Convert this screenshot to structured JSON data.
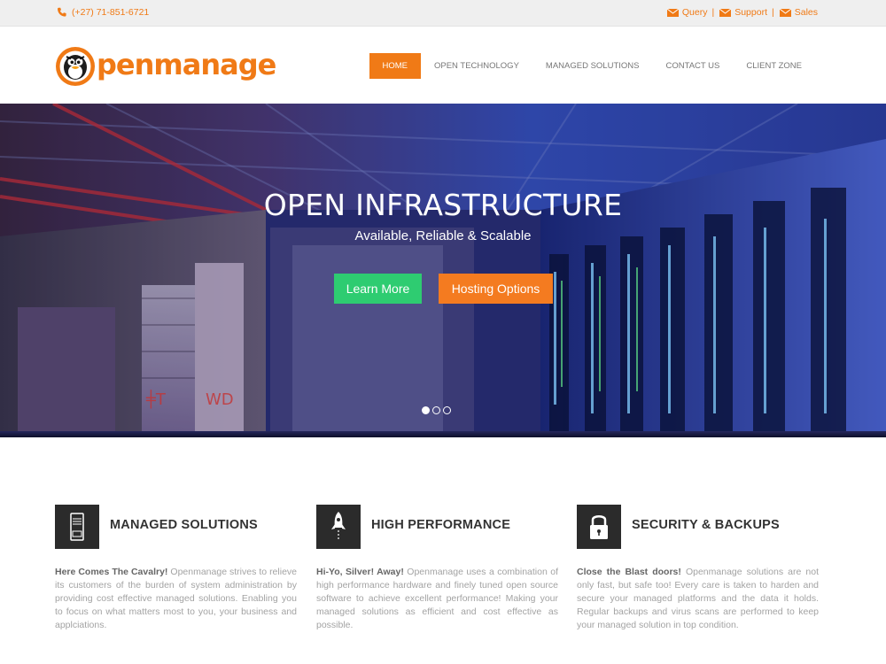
{
  "topbar": {
    "phone": "(+27) 71-851-6721",
    "links": [
      {
        "label": "Query",
        "icon": "mail-icon"
      },
      {
        "label": "Support",
        "icon": "mail-icon"
      },
      {
        "label": "Sales",
        "icon": "mail-icon"
      }
    ],
    "separator": "|"
  },
  "brand": {
    "name": "penmanage",
    "logo_icon": "penguin-logo-icon",
    "color": "#f07a16"
  },
  "nav": {
    "items": [
      {
        "label": "HOME",
        "active": true
      },
      {
        "label": "OPEN TECHNOLOGY"
      },
      {
        "label": "MANAGED SOLUTIONS"
      },
      {
        "label": "CONTACT US"
      },
      {
        "label": "CLIENT ZONE"
      }
    ]
  },
  "hero": {
    "title": "OPEN INFRASTRUCTURE",
    "subtitle": "Available, Reliable & Scalable",
    "buttons": [
      {
        "label": "Learn More",
        "color": "#2ecc71"
      },
      {
        "label": "Hosting Options",
        "color": "#f47b20"
      }
    ],
    "slides": 3,
    "active_slide": 1
  },
  "features": [
    {
      "icon": "server-icon",
      "title": "MANAGED SOLUTIONS",
      "lead": "Here Comes The Cavalry!",
      "text": " Openmanage strives to relieve its customers of the burden of system administration by providing cost effective managed solutions. Enabling you to focus on what matters most to you, your business and applciations."
    },
    {
      "icon": "rocket-icon",
      "title": "HIGH PERFORMANCE",
      "lead": "Hi-Yo, Silver! Away!",
      "text": " Openmanage uses a combination of high performance hardware and finely tuned open source software to achieve excellent performance! Making your managed solutions as efficient and cost effective as possible."
    },
    {
      "icon": "padlock-icon",
      "title": "SECURITY & BACKUPS",
      "lead": "Close the Blast doors!",
      "text": " Openmanage solutions are not only fast, but safe too! Every care is taken to harden and secure your managed platforms and the data it holds. Regular backups and virus scans are performed to keep your managed solution in top condition."
    }
  ],
  "colors": {
    "accent": "#f07a16",
    "green": "#2ecc71",
    "dark": "#2b2b2b"
  }
}
